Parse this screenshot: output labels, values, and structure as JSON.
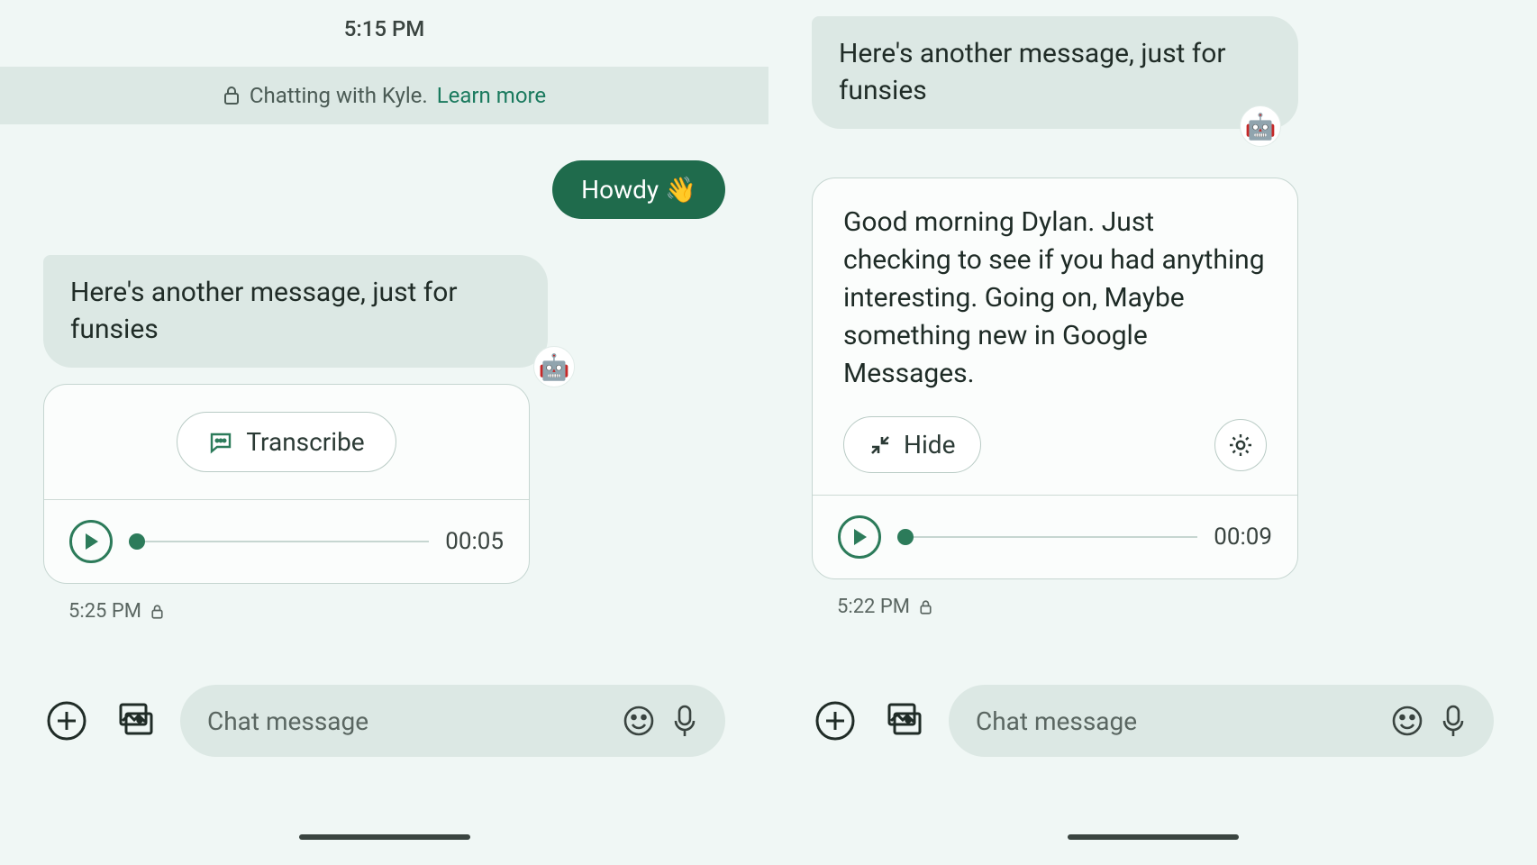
{
  "left": {
    "header_time": "5:15 PM",
    "banner_prefix": "Chatting with Kyle.",
    "banner_link": "Learn more",
    "outgoing": "Howdy 👋",
    "incoming": "Here's another message, just for funsies",
    "avatar_emoji": "🤖",
    "transcribe_label": "Transcribe",
    "audio_duration": "00:05",
    "meta_time": "5:25 PM",
    "input_placeholder": "Chat message"
  },
  "right": {
    "incoming": "Here's another message, just for funsies",
    "avatar_emoji": "🤖",
    "transcript": "Good morning Dylan. Just checking to see if you had anything interesting. Going on, Maybe something new in Google Messages.",
    "hide_label": "Hide",
    "audio_duration": "00:09",
    "meta_time": "5:22 PM",
    "input_placeholder": "Chat message"
  }
}
